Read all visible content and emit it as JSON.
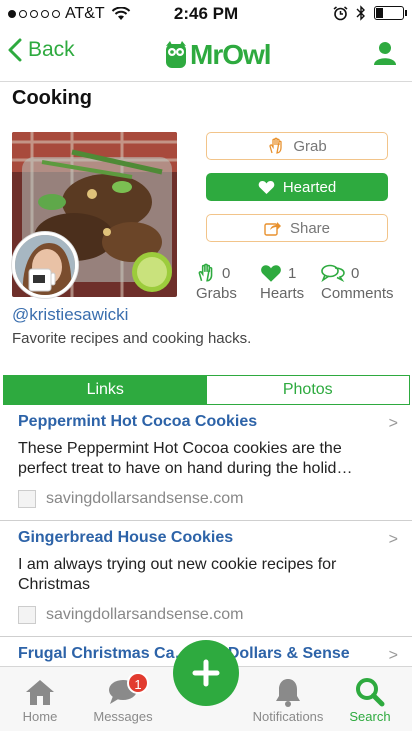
{
  "status_bar": {
    "carrier": "AT&T",
    "time": "2:46 PM",
    "battery_level": 0.25
  },
  "navbar": {
    "back_label": "Back",
    "logo_text": "MrOwl",
    "profile_icon": "person-icon"
  },
  "board": {
    "title": "Cooking",
    "handle": "@kristiesawicki",
    "description": "Favorite recipes and cooking hacks."
  },
  "actions": {
    "grab_label": "Grab",
    "hearted_label": "Hearted",
    "share_label": "Share"
  },
  "stats": {
    "grabs": {
      "count": "0",
      "label": "Grabs"
    },
    "hearts": {
      "count": "1",
      "label": "Hearts"
    },
    "comments": {
      "count": "0",
      "label": "Comments"
    }
  },
  "tabs": {
    "links": "Links",
    "photos": "Photos"
  },
  "items": [
    {
      "title": "Peppermint Hot Cocoa Cookies",
      "description": "These Peppermint Hot Cocoa cookies are the perfect treat to have on hand during the holid…",
      "source": "savingdollarsandsense.com"
    },
    {
      "title": "Gingerbread House Cookies",
      "description": "I am always trying out new cookie recipes for Christmas",
      "source": "savingdollarsandsense.com"
    },
    {
      "title": "Frugal Christmas Ca…ving Dollars & Sense",
      "description": "",
      "source": ""
    }
  ],
  "tabbar": {
    "home": "Home",
    "messages": "Messages",
    "messages_badge": "1",
    "notifications": "Notifications",
    "search": "Search"
  },
  "colors": {
    "brand_green": "#2eaa3f",
    "link_blue": "#2d63a8",
    "badge_red": "#e23b2f"
  },
  "chevron": ">"
}
